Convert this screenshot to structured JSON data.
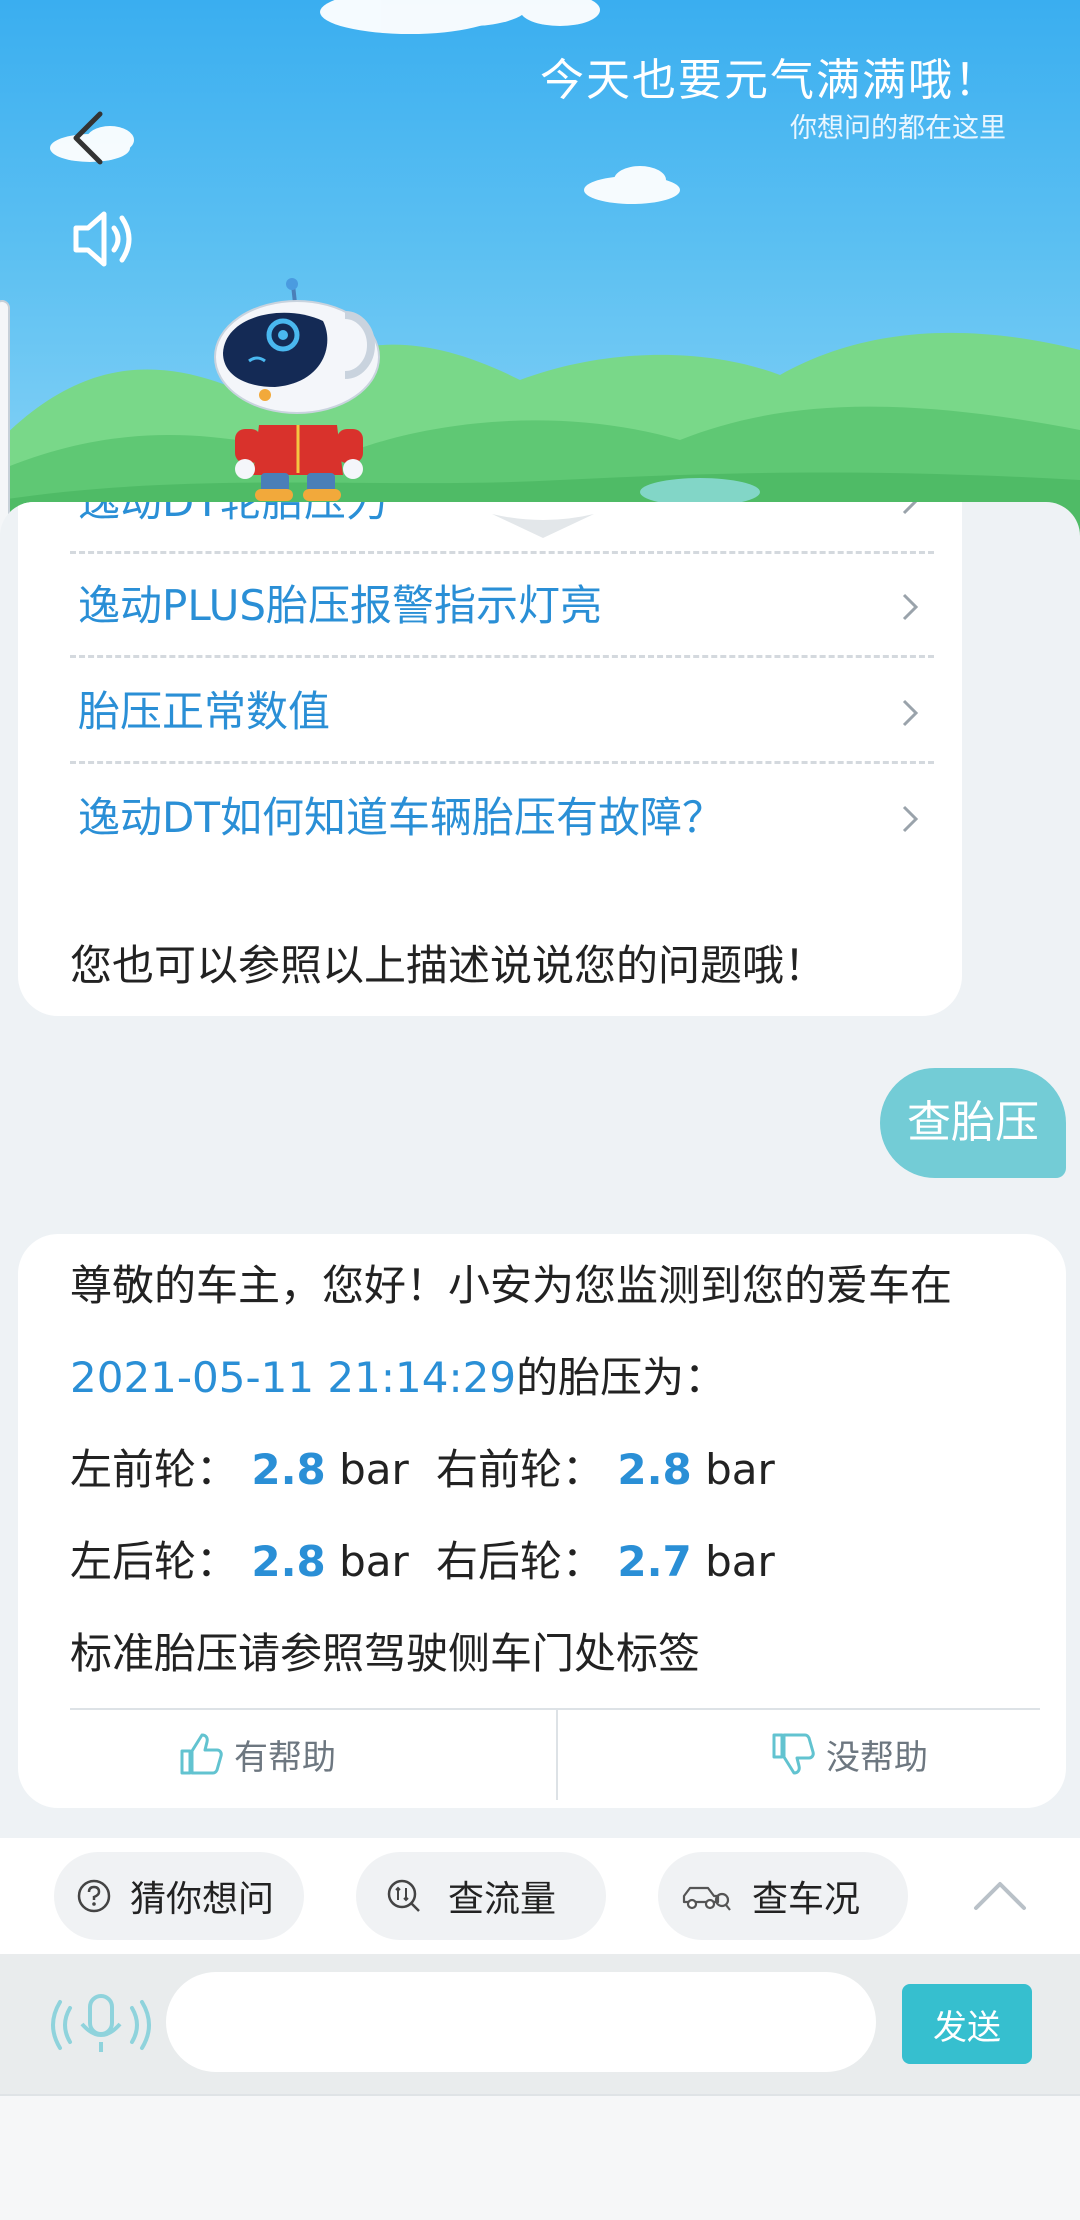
{
  "header": {
    "title": "今天也要元气满满哦！",
    "subtitle": "你想问的都在这里"
  },
  "icons": {
    "back": "chevron-left-icon",
    "speaker": "speaker-icon",
    "mascot": "robot-mascot",
    "chevron": "chevron-right-icon",
    "thumbs_up": "thumbs-up-icon",
    "thumbs_down": "thumbs-down-icon",
    "question": "question-circle-icon",
    "data": "data-traffic-icon",
    "car": "car-search-icon",
    "mic": "microphone-icon"
  },
  "faq": {
    "items": [
      {
        "label": "逸动DT轮胎压力"
      },
      {
        "label": "逸动PLUS胎压报警指示灯亮"
      },
      {
        "label": "胎压正常数值"
      },
      {
        "label": "逸动DT如何知道车辆胎压有故障？"
      }
    ],
    "hint": "您也可以参照以上描述说说您的问题哦！"
  },
  "user_message": "查胎压",
  "answer": {
    "greeting": "尊敬的车主，您好！小安为您监测到您的爱车在",
    "timestamp": "2021-05-11 21:14:29",
    "suffix": "的胎压为：",
    "unit": "bar",
    "tires": {
      "front_left": {
        "label": "左前轮：",
        "value": "2.8"
      },
      "front_right": {
        "label": "右前轮：",
        "value": "2.8"
      },
      "rear_left": {
        "label": "左后轮：",
        "value": "2.8"
      },
      "rear_right": {
        "label": "右后轮：",
        "value": "2.7"
      }
    },
    "note": "标准胎压请参照驾驶侧车门处标签",
    "helpful_label": "有帮助",
    "not_helpful_label": "没帮助"
  },
  "quick_actions": [
    {
      "label": "猜你想问"
    },
    {
      "label": "查流量"
    },
    {
      "label": "查车况"
    }
  ],
  "input": {
    "value": "",
    "send_label": "发送"
  },
  "colors": {
    "accent_blue": "#2a8fd6",
    "teal": "#36bfcf",
    "user_bubble": "#73ccd6",
    "sky_top": "#3aaef0"
  }
}
